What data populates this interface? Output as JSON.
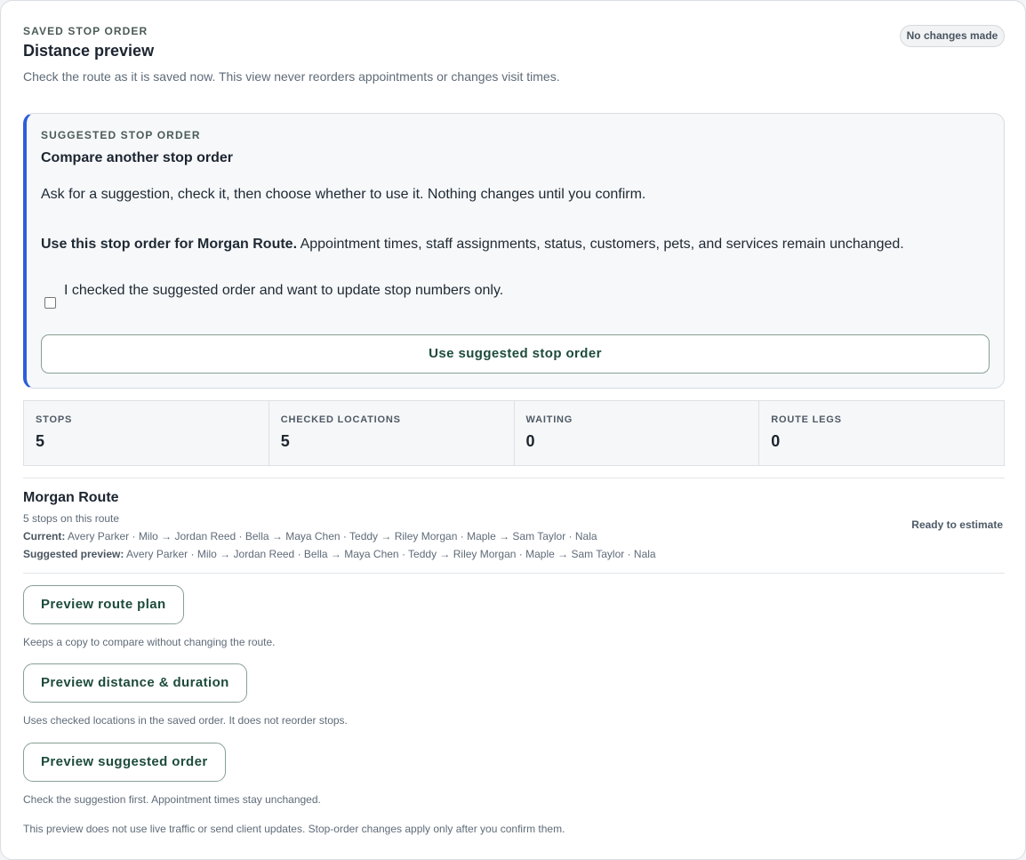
{
  "header": {
    "eyebrow": "SAVED STOP ORDER",
    "title": "Distance preview",
    "subtitle": "Check the route as it is saved now. This view never reorders appointments or changes visit times.",
    "badge": "No changes made"
  },
  "suggestion": {
    "eyebrow": "SUGGESTED STOP ORDER",
    "title": "Compare another stop order",
    "description": "Ask for a suggestion, check it, then choose whether to use it. Nothing changes until you confirm.",
    "use_bold": "Use this stop order for Morgan Route.",
    "use_rest": " Appointment times, staff assignments, status, customers, pets, and services remain unchanged.",
    "checkbox_label": "I checked the suggested order and want to update stop numbers only.",
    "checkbox_checked": false,
    "button_label": "Use suggested stop order"
  },
  "stats": [
    {
      "label": "STOPS",
      "value": "5"
    },
    {
      "label": "CHECKED LOCATIONS",
      "value": "5"
    },
    {
      "label": "WAITING",
      "value": "0"
    },
    {
      "label": "ROUTE LEGS",
      "value": "0"
    }
  ],
  "route": {
    "name": "Morgan Route",
    "count": "5 stops on this route",
    "current_label": "Current:",
    "current_value": " Avery Parker · Milo → Jordan Reed · Bella → Maya Chen · Teddy → Riley Morgan · Maple → Sam Taylor · Nala",
    "suggested_label": "Suggested preview:",
    "suggested_value": " Avery Parker · Milo → Jordan Reed · Bella → Maya Chen · Teddy → Riley Morgan · Maple → Sam Taylor · Nala",
    "status": "Ready to estimate"
  },
  "actions": [
    {
      "label": "Preview route plan",
      "note": "Keeps a copy to compare without changing the route."
    },
    {
      "label": "Preview distance & duration",
      "note": "Uses checked locations in the saved order. It does not reorder stops."
    },
    {
      "label": "Preview suggested order",
      "note": "Check the suggestion first. Appointment times stay unchanged."
    }
  ],
  "footer": "This preview does not use live traffic or send client updates. Stop-order changes apply only after you confirm them.",
  "colors": {
    "accent": "#2b5fd9",
    "button_text": "#1d4b3c",
    "button_border": "#87a094"
  }
}
